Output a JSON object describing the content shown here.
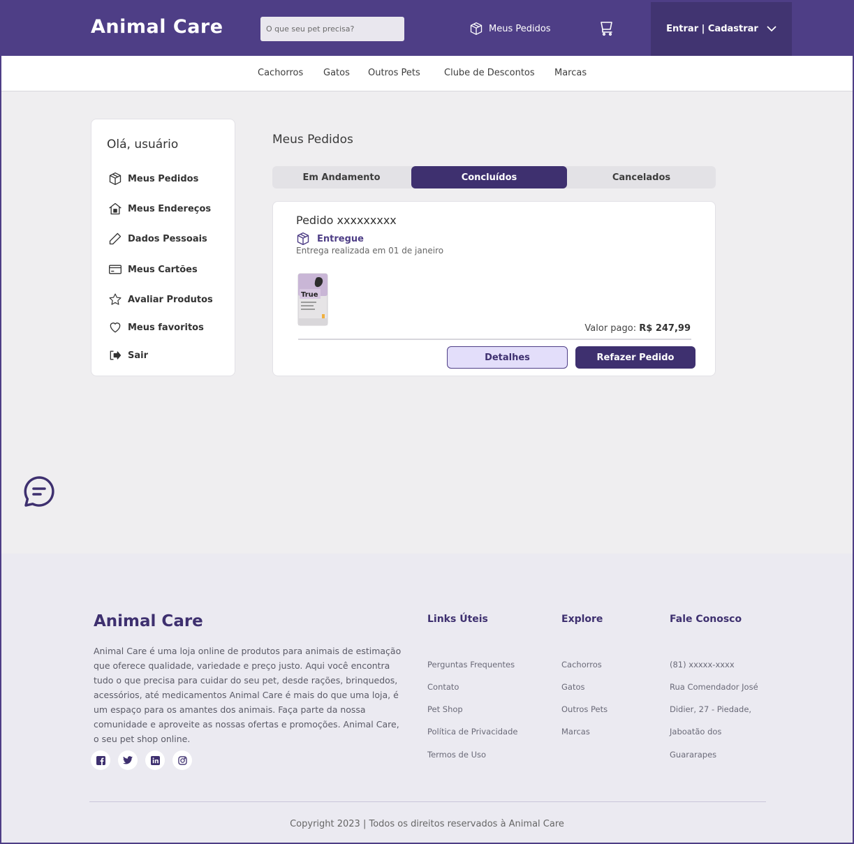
{
  "header": {
    "logo": "Animal Care",
    "search_placeholder": "O que seu pet precisa?",
    "orders_label": "Meus Pedidos",
    "login_label": "Entrar | Cadastrar"
  },
  "nav": {
    "items": [
      "Cachorros",
      "Gatos",
      "Outros Pets",
      "Clube de Descontos",
      "Marcas"
    ]
  },
  "sidebar": {
    "greeting": "Olá, usuário",
    "items": [
      {
        "label": "Meus Pedidos",
        "icon": "box-icon"
      },
      {
        "label": "Meus Endereços",
        "icon": "home-icon"
      },
      {
        "label": "Dados Pessoais",
        "icon": "pencil-icon"
      },
      {
        "label": "Meus Cartões",
        "icon": "card-icon"
      },
      {
        "label": "Avaliar Produtos",
        "icon": "star-icon"
      },
      {
        "label": "Meus favoritos",
        "icon": "heart-icon"
      },
      {
        "label": "Sair",
        "icon": "logout-icon"
      }
    ]
  },
  "main": {
    "title": "Meus Pedidos",
    "tabs": [
      "Em Andamento",
      "Concluídos",
      "Cancelados"
    ],
    "active_tab": "Concluídos",
    "order": {
      "title": "Pedido xxxxxxxxx",
      "status": "Entregue",
      "date": "Entrega realizada em 01 de janeiro",
      "paid_label": "Valor pago:",
      "paid_value": "R$ 247,99",
      "product_brand": "True",
      "details_button": "Detalhes",
      "reorder_button": "Refazer Pedido"
    }
  },
  "footer": {
    "logo": "Animal Care",
    "description": "Animal Care é uma loja online de produtos para animais de estimação que oferece qualidade, variedade e preço justo. Aqui você encontra tudo o que precisa para cuidar do seu pet, desde rações, brinquedos, acessórios, até medicamentos Animal Care é mais do que uma loja, é um espaço para os amantes dos animais. Faça parte da nossa comunidade e aproveite as nossas ofertas e promoções. Animal Care, o seu pet shop online.",
    "columns": [
      {
        "title": "Links Úteis",
        "links": [
          "Perguntas Frequentes",
          "Contato",
          "Pet Shop",
          "Política de Privacidade",
          "Termos de Uso"
        ]
      },
      {
        "title": "Explore",
        "links": [
          "Cachorros",
          "Gatos",
          "Outros Pets",
          "Marcas"
        ]
      },
      {
        "title": "Fale Conosco",
        "links": [
          "(81) xxxxx-xxxx",
          "Rua Comendador José",
          "Didier, 27 - Piedade,",
          "Jaboatão dos",
          "Guararapes"
        ]
      }
    ],
    "copyright": "Copyright 2023 | Todos os direitos reservados à Animal Care"
  },
  "colors": {
    "primary": "#4e3e86",
    "primary_dark": "#3e306f",
    "accent_light": "#e3defa",
    "background": "#efeef0",
    "footer_bg": "#ebeaf1"
  }
}
